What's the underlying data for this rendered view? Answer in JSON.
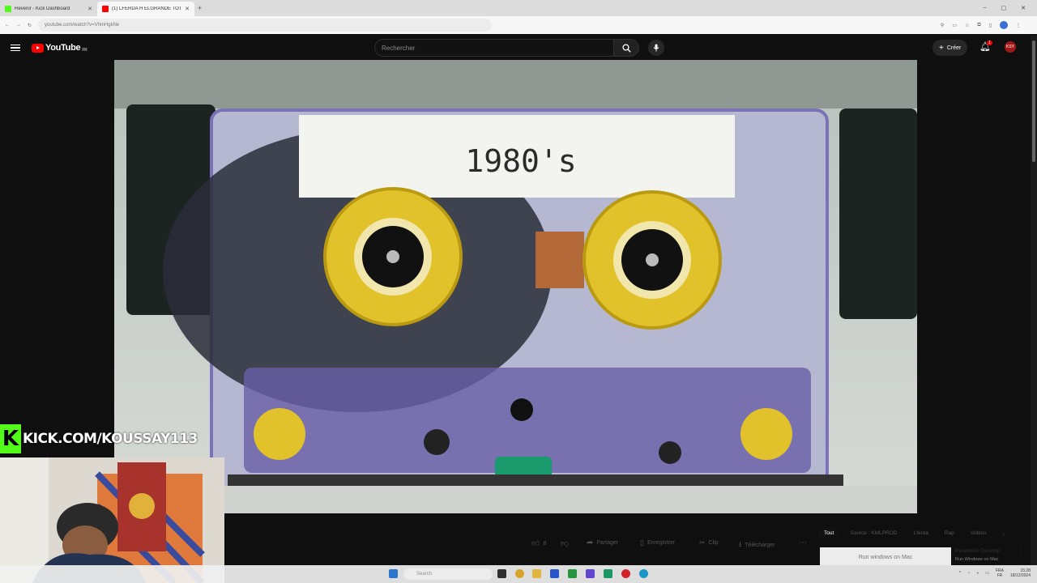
{
  "browser": {
    "tabs": [
      {
        "title": "Revenir - Kick Dashboard",
        "color": "#53fc18"
      },
      {
        "title": "(1) LFERDA H ELGRANDE TOTO",
        "color": "#ff0000"
      }
    ],
    "url": "youtube.com/watch?v=VhmHgkNe",
    "window_controls": [
      "–",
      "▢",
      "✕"
    ]
  },
  "youtube": {
    "logo_text": "YouTube",
    "region": "FR",
    "search_placeholder": "Rechercher",
    "create_label": "Créer",
    "notifications_count": "1",
    "avatar_text": "KSY"
  },
  "video": {
    "label_text": "1980's"
  },
  "overlay": {
    "kick_logo": "K",
    "kick_url": "KICK.COM/KOUSSAY113"
  },
  "actions": {
    "likes": "8",
    "share_label": "Partager",
    "save_label": "Enregistrer",
    "clip_label": "Clip",
    "download_label": "Télécharger",
    "more_label": "⋯"
  },
  "chips": [
    "Tout",
    "Source : KMLPROD",
    "Lferda",
    "Rap",
    "Vidéos"
  ],
  "ad": {
    "text": "Run windows on Mac",
    "title": "Parallels® Desktop",
    "subtitle": "Run Windows on Mac"
  },
  "taskbar": {
    "search_placeholder": "Search",
    "lang_line1": "FRA",
    "lang_line2": "FR",
    "time": "15:28",
    "date": "18/12/2024"
  },
  "colors": {
    "accent": "#ff0000",
    "kick": "#53fc18",
    "chip_active": "#111111"
  }
}
